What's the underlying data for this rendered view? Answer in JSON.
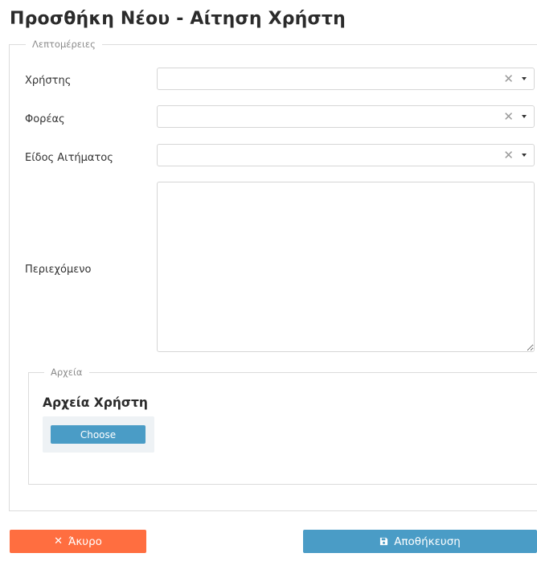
{
  "page": {
    "title": "Προσθήκη Νέου - Αίτηση Χρήστη"
  },
  "details": {
    "legend": "Λεπτομέρειες",
    "user": {
      "label": "Χρήστης",
      "value": ""
    },
    "organization": {
      "label": "Φορέας",
      "value": ""
    },
    "request_type": {
      "label": "Είδος Αιτήματος",
      "value": ""
    },
    "content": {
      "label": "Περιεχόμενο",
      "value": ""
    }
  },
  "files": {
    "legend": "Αρχεία",
    "title": "Αρχεία Χρήστη",
    "choose_label": "Choose"
  },
  "actions": {
    "cancel_label": "Άκυρο",
    "save_label": "Αποθήκευση"
  },
  "icons": {
    "clear": "close-icon",
    "dropdown": "caret-down-icon",
    "cancel": "close-icon",
    "save": "floppy-disk-icon"
  },
  "colors": {
    "cancel": "#ff6e40",
    "primary": "#4a9cc6",
    "upload_panel": "#eef2f5"
  }
}
